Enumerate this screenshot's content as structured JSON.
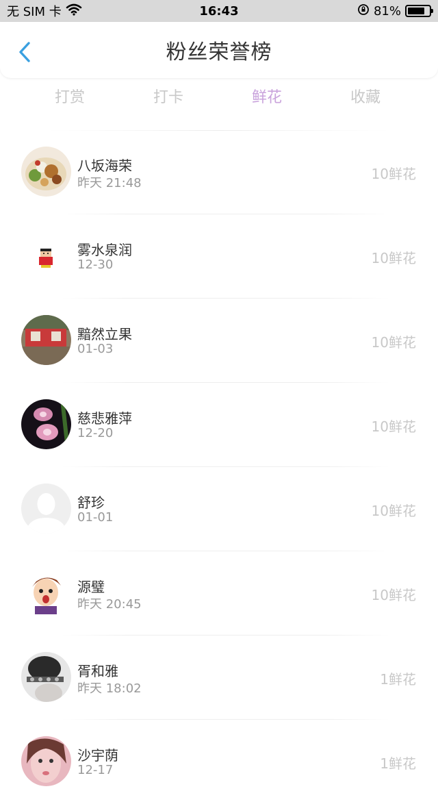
{
  "status": {
    "carrier": "无 SIM 卡",
    "time": "16:43",
    "battery": "81%",
    "battery_level": 0.81
  },
  "header": {
    "title": "粉丝荣誉榜"
  },
  "tabs": [
    {
      "label": "打赏",
      "active": false
    },
    {
      "label": "打卡",
      "active": false
    },
    {
      "label": "鲜花",
      "active": true
    },
    {
      "label": "收藏",
      "active": false
    }
  ],
  "fans": [
    {
      "name": "八坂海荣",
      "time": "昨天 21:48",
      "count": "10鲜花",
      "avatar": "food-plate"
    },
    {
      "name": "雾水泉润",
      "time": "12-30",
      "count": "10鲜花",
      "avatar": "cartoon-boy"
    },
    {
      "name": "黯然立果",
      "time": "01-03",
      "count": "10鲜花",
      "avatar": "red-stage"
    },
    {
      "name": "慈悲雅萍",
      "time": "12-20",
      "count": "10鲜花",
      "avatar": "pink-orchid"
    },
    {
      "name": "舒珍",
      "time": "01-01",
      "count": "10鲜花",
      "avatar": "default-user"
    },
    {
      "name": "源璧",
      "time": "昨天 20:45",
      "count": "10鲜花",
      "avatar": "cartoon-face"
    },
    {
      "name": "胥和雅",
      "time": "昨天 18:02",
      "count": "1鲜花",
      "avatar": "hat-portrait"
    },
    {
      "name": "沙宇荫",
      "time": "12-17",
      "count": "1鲜花",
      "avatar": "selfie-portrait"
    }
  ],
  "colors": {
    "accent": "#c9a3dc",
    "back_arrow": "#3aa0e0",
    "muted": "#c8c8c8"
  }
}
